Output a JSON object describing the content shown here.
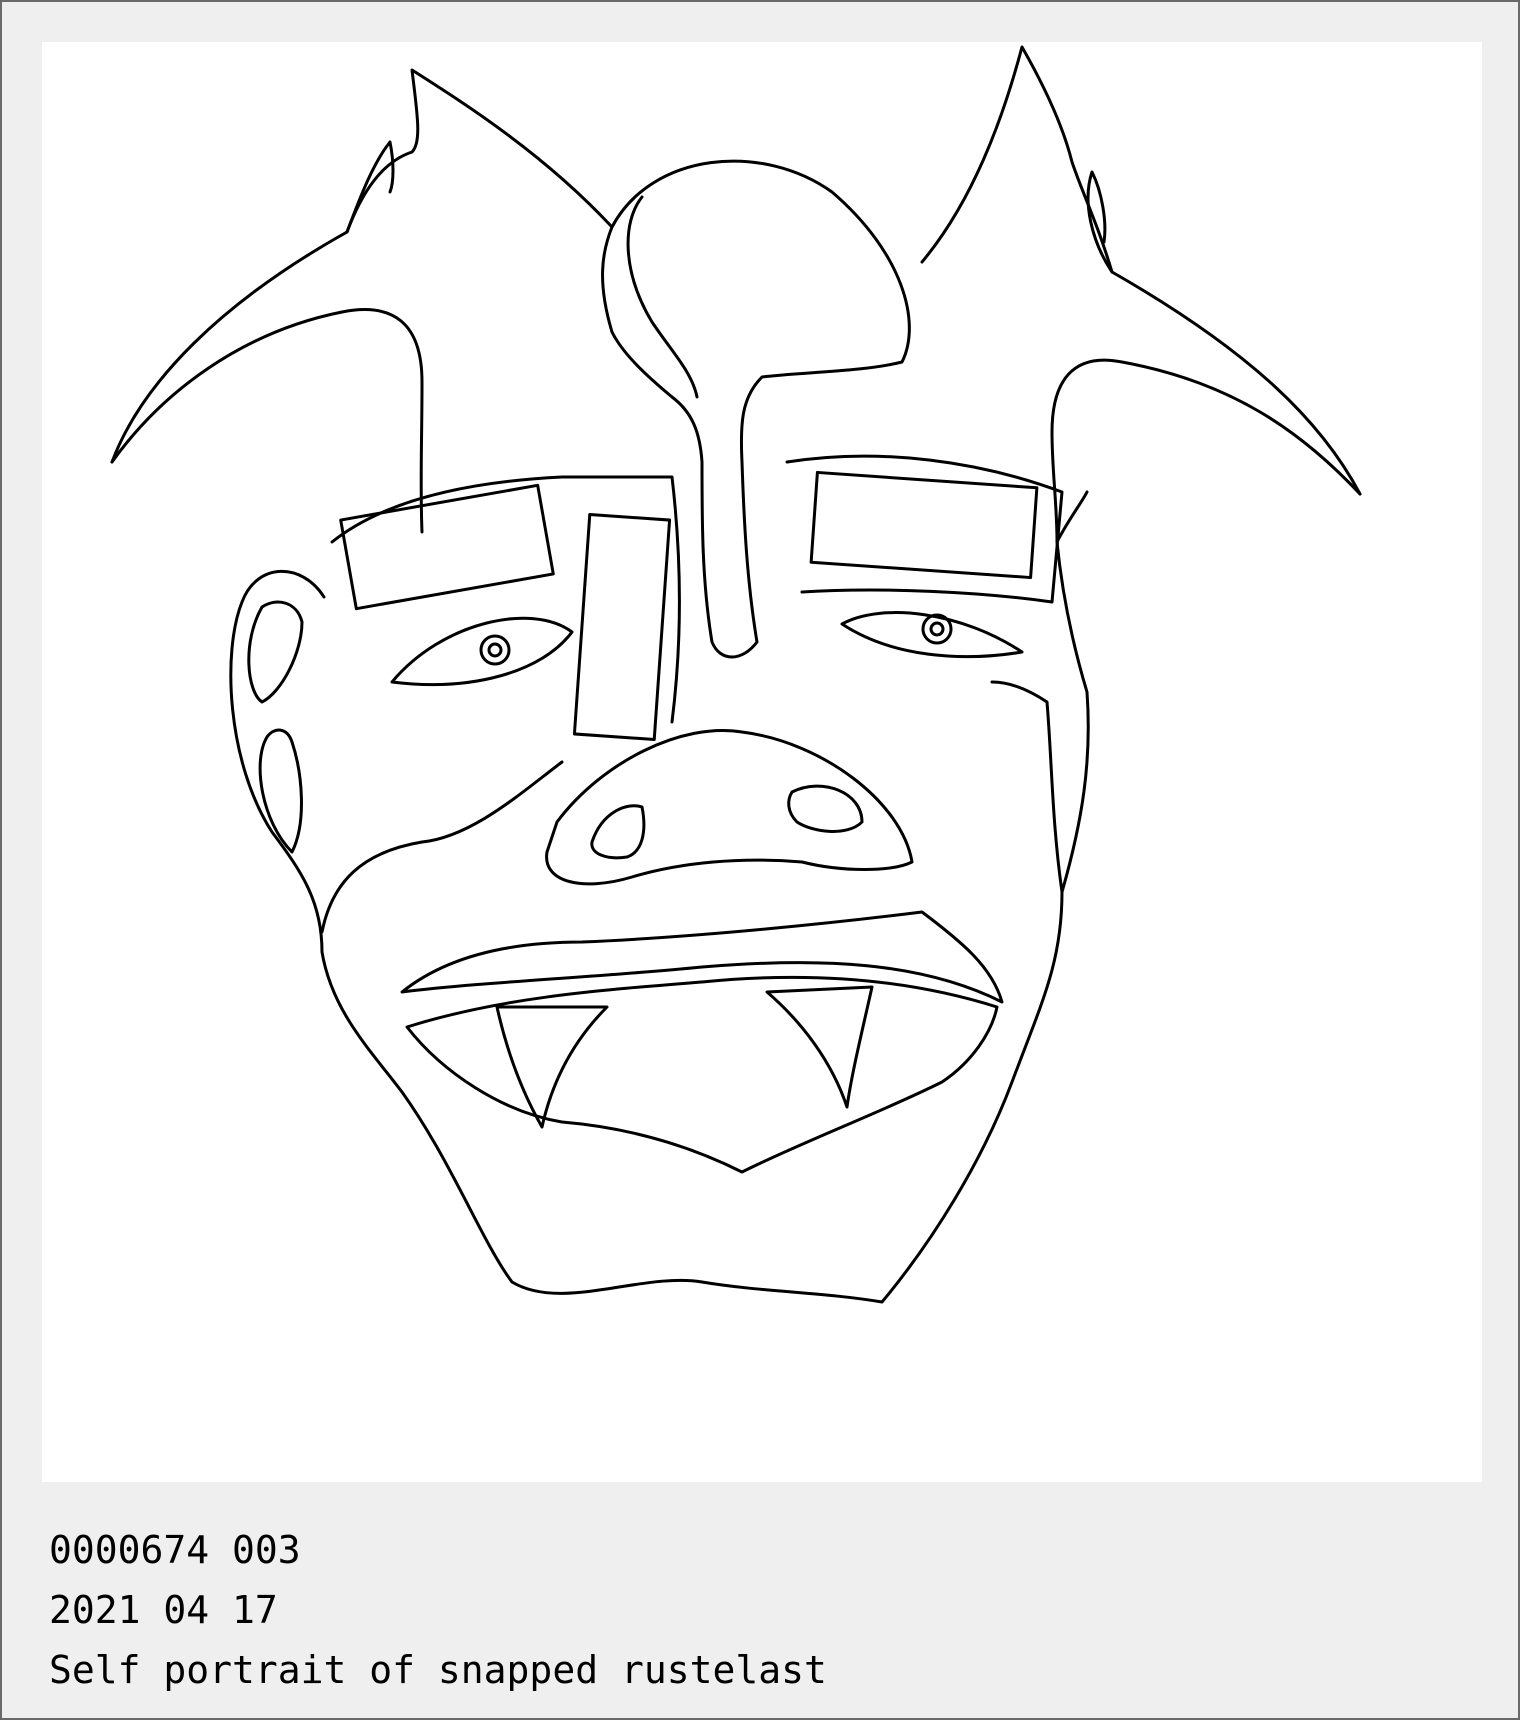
{
  "caption": {
    "id_line": "0000674 003",
    "date_line": "2021 04 17",
    "title_line": "Self portrait of snapped rustelast"
  },
  "artwork": {
    "kind": "line drawing",
    "subject": "horned mask face",
    "stroke_color": "#000000",
    "background_color": "#ffffff"
  },
  "colors": {
    "page_background": "#efefef",
    "frame_border": "#6a6a6a"
  }
}
